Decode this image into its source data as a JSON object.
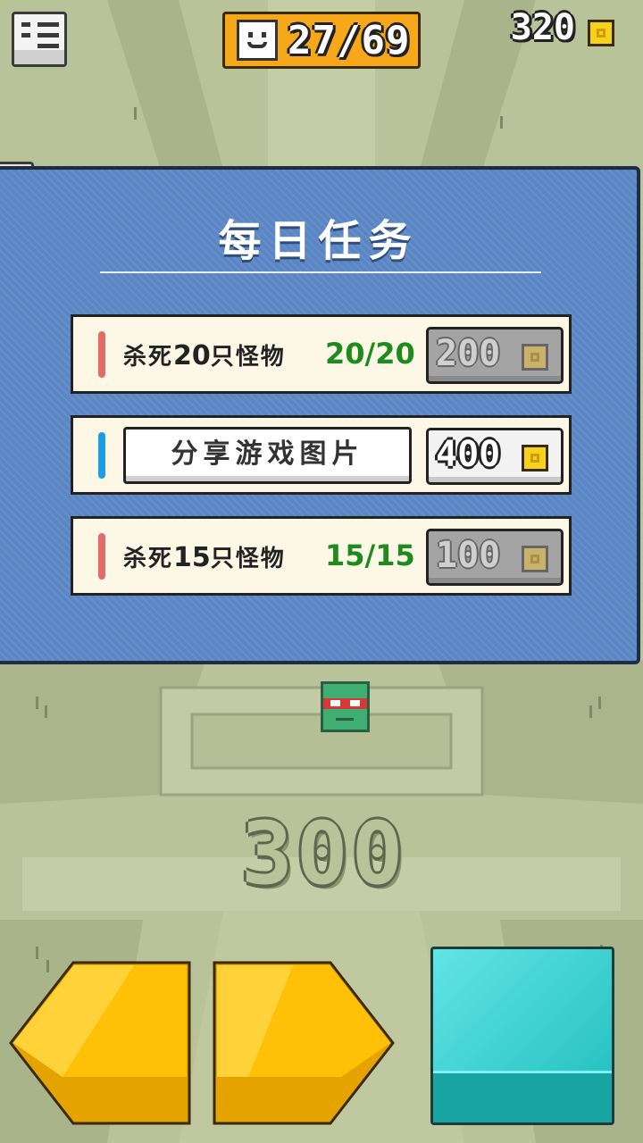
{
  "hud": {
    "progress": "27/69",
    "coins": "320"
  },
  "hp": {
    "level": 0.15
  },
  "modal": {
    "title": "每日任务",
    "tasks": [
      {
        "text_a": "杀死",
        "num": "20",
        "text_b": "只怪物",
        "count": "20/20",
        "reward": "200",
        "status": "claimed",
        "mark_color": "#e56a6a"
      },
      {
        "button_label": "分享游戏图片",
        "reward": "400",
        "status": "active",
        "mark_color": "#1e9ee2"
      },
      {
        "text_a": "杀死",
        "num": "15",
        "text_b": "只怪物",
        "count": "15/15",
        "reward": "100",
        "status": "claimed",
        "mark_color": "#e56a6a"
      }
    ]
  },
  "score": "300",
  "colors": {
    "accent_orange": "#f6a81a",
    "modal_blue": "#5b86c4",
    "move_button": "#ffc107",
    "jump_button": "#2ccaca",
    "complete_green": "#1d8c1d"
  }
}
